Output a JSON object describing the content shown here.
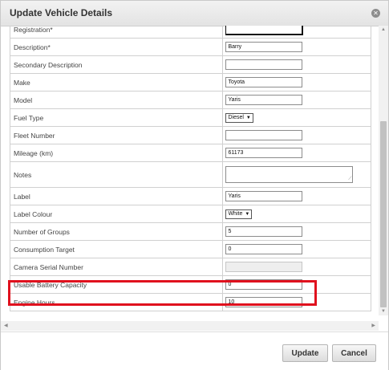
{
  "dialog": {
    "title": "Update Vehicle Details",
    "close_icon": "close-circle-icon"
  },
  "form": {
    "rows": [
      {
        "label": "Registration*",
        "type": "input",
        "value": "",
        "variant": "dark"
      },
      {
        "label": "Description*",
        "type": "input",
        "value": "Barry"
      },
      {
        "label": "Secondary Description",
        "type": "input",
        "value": ""
      },
      {
        "label": "Make",
        "type": "input",
        "value": "Toyota"
      },
      {
        "label": "Model",
        "type": "input",
        "value": "Yaris"
      },
      {
        "label": "Fuel Type",
        "type": "select",
        "value": "Diesel"
      },
      {
        "label": "Fleet Number",
        "type": "input",
        "value": ""
      },
      {
        "label": "Mileage (km)",
        "type": "input",
        "value": "61173"
      },
      {
        "label": "Notes",
        "type": "textarea",
        "value": ""
      },
      {
        "label": "Label",
        "type": "input",
        "value": "Yaris"
      },
      {
        "label": "Label Colour",
        "type": "select",
        "value": "White"
      },
      {
        "label": "Number of Groups",
        "type": "input",
        "value": "5"
      },
      {
        "label": "Consumption Target",
        "type": "input",
        "value": "0"
      },
      {
        "label": "Camera Serial Number",
        "type": "input",
        "value": "",
        "disabled": true
      },
      {
        "label": "Usable Battery Capacity",
        "type": "input",
        "value": "0"
      },
      {
        "label": "Engine Hours",
        "type": "input",
        "value": "10"
      }
    ]
  },
  "footer": {
    "update_label": "Update",
    "cancel_label": "Cancel"
  },
  "colors": {
    "highlight": "#e0111e"
  }
}
